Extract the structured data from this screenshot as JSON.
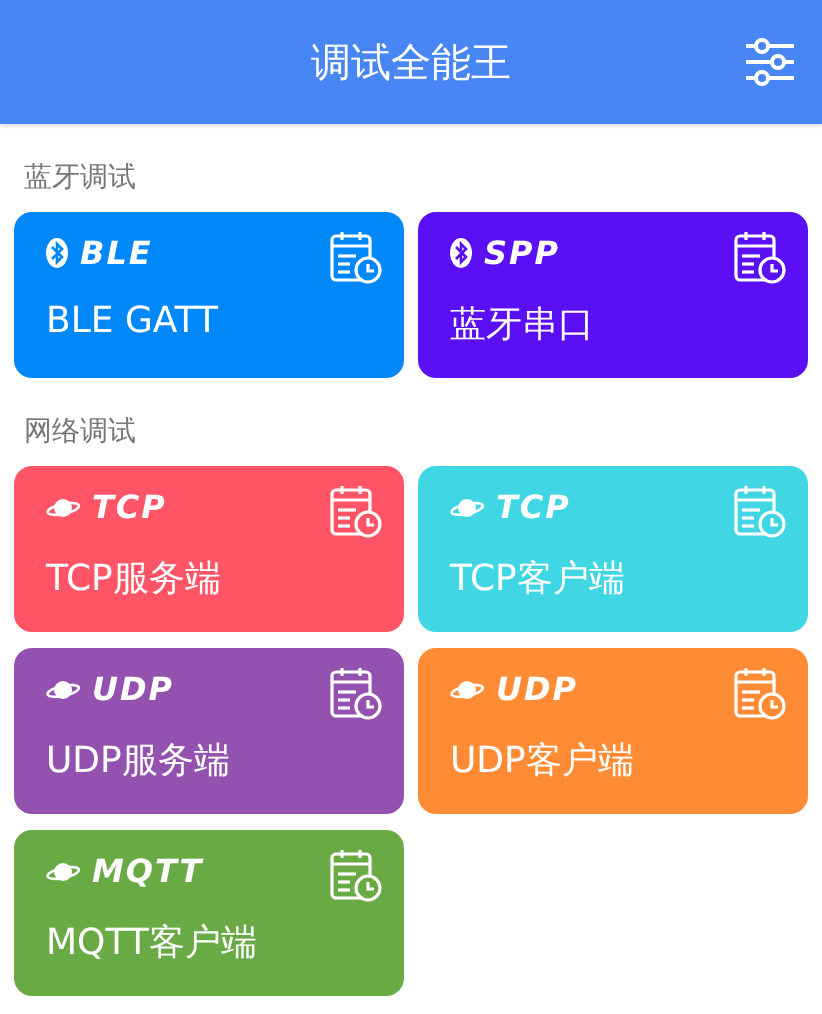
{
  "header": {
    "title": "调试全能王"
  },
  "sections": [
    {
      "label": "蓝牙调试",
      "cards": [
        {
          "kind": "bluetooth",
          "tag": "BLE",
          "title": "BLE GATT",
          "color": "#0088fa"
        },
        {
          "kind": "bluetooth",
          "tag": "SPP",
          "title": "蓝牙串口",
          "color": "#5a0ff5"
        }
      ]
    },
    {
      "label": "网络调试",
      "cards": [
        {
          "kind": "planet",
          "tag": "TCP",
          "title": "TCP服务端",
          "color": "#ff5566"
        },
        {
          "kind": "planet",
          "tag": "TCP",
          "title": "TCP客户端",
          "color": "#40d6e4"
        },
        {
          "kind": "planet",
          "tag": "UDP",
          "title": "UDP服务端",
          "color": "#9452b0"
        },
        {
          "kind": "planet",
          "tag": "UDP",
          "title": "UDP客户端",
          "color": "#ff8c35"
        },
        {
          "kind": "planet",
          "tag": "MQTT",
          "title": "MQTT客户端",
          "color": "#6aaa45"
        }
      ]
    }
  ]
}
